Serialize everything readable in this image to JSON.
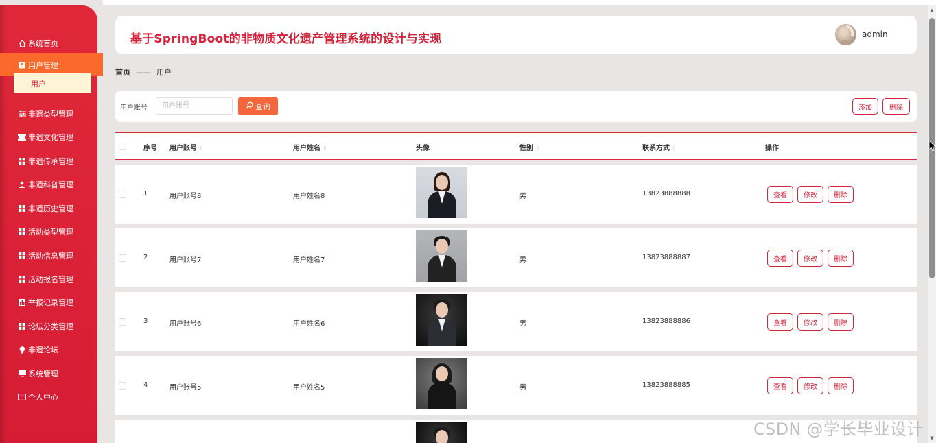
{
  "app": {
    "title": "基于SpringBoot的非物质文化遗产管理系统的设计与实现",
    "username": "admin"
  },
  "sidebar": {
    "items": [
      {
        "label": "系统首页",
        "icon": "home-icon"
      },
      {
        "label": "用户管理",
        "icon": "user-manage-icon",
        "active": true
      },
      {
        "label": "非遗类型管理",
        "icon": "sliders-icon"
      },
      {
        "label": "非遗文化管理",
        "icon": "ticket-icon"
      },
      {
        "label": "非遗传承管理",
        "icon": "grid-icon"
      },
      {
        "label": "非遗科普管理",
        "icon": "person-icon"
      },
      {
        "label": "非遗历史管理",
        "icon": "grid-icon"
      },
      {
        "label": "活动类型管理",
        "icon": "grid-icon"
      },
      {
        "label": "活动信息管理",
        "icon": "grid-icon"
      },
      {
        "label": "活动报名管理",
        "icon": "grid-icon"
      },
      {
        "label": "举报记录管理",
        "icon": "report-icon"
      },
      {
        "label": "论坛分类管理",
        "icon": "grid-icon"
      },
      {
        "label": "非遗论坛",
        "icon": "bulb-icon"
      },
      {
        "label": "系统管理",
        "icon": "monitor-icon"
      },
      {
        "label": "个人中心",
        "icon": "card-icon"
      }
    ],
    "submenu": {
      "label": "用户"
    }
  },
  "breadcrumb": {
    "home": "首页",
    "separator": "——",
    "current": "用户"
  },
  "search": {
    "label": "用户账号",
    "placeholder": "用户账号",
    "query_label": "查询",
    "add_label": "添加",
    "delete_label": "删除"
  },
  "table": {
    "headers": {
      "index": "序号",
      "account": "用户账号",
      "name": "用户姓名",
      "avatar": "头像",
      "gender": "性别",
      "phone": "联系方式",
      "actions": "操作"
    },
    "rows": [
      {
        "index": "1",
        "account": "用户账号8",
        "name": "用户姓名8",
        "gender": "男",
        "phone": "13823888888"
      },
      {
        "index": "2",
        "account": "用户账号7",
        "name": "用户姓名7",
        "gender": "男",
        "phone": "13823888887"
      },
      {
        "index": "3",
        "account": "用户账号6",
        "name": "用户姓名6",
        "gender": "男",
        "phone": "13823888886"
      },
      {
        "index": "4",
        "account": "用户账号5",
        "name": "用户姓名5",
        "gender": "男",
        "phone": "13823888885"
      }
    ],
    "row_actions": {
      "view": "查看",
      "edit": "修改",
      "delete": "删除"
    }
  },
  "watermark": "CSDN @学长毕业设计",
  "colors": {
    "sidebar": "#d61c34",
    "active_menu": "#fb6a2c",
    "title": "#d4233b",
    "query_button": "#f6663c",
    "submenu_bg": "#fff4d5"
  }
}
